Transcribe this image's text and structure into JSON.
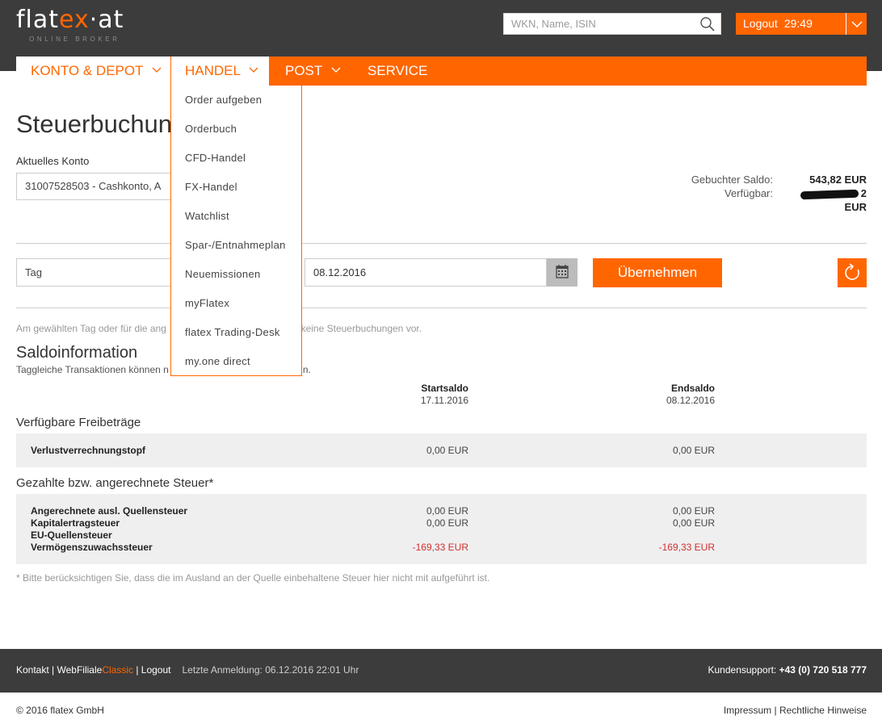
{
  "header": {
    "logo_main": "flat",
    "logo_accent": "ex",
    "logo_tail": "·at",
    "logo_sub": "ONLINE BROKER",
    "search_placeholder": "WKN, Name, ISIN",
    "logout_label": "Logout",
    "session_timer": "29:49"
  },
  "nav": {
    "items": [
      {
        "label": "KONTO & DEPOT"
      },
      {
        "label": "HANDEL"
      },
      {
        "label": "POST"
      },
      {
        "label": "SERVICE"
      }
    ]
  },
  "handel_menu": [
    "Order aufgeben",
    "Orderbuch",
    "CFD-Handel",
    "FX-Handel",
    "Watchlist",
    "Spar-/Entnahmeplan",
    "Neuemissionen",
    "myFlatex",
    "flatex Trading-Desk",
    "my.one direct"
  ],
  "page": {
    "title": "Steuerbuchungen",
    "account_label": "Aktuelles Konto",
    "account_value": "31007528503 - Cashkonto, A",
    "booked_balance_label": "Gebuchter Saldo:",
    "booked_balance_value": "543,82 EUR",
    "available_label": "Verfügbar:",
    "available_value_tail": "2 EUR"
  },
  "filter": {
    "period_value": "Tag",
    "date_value": "08.12.2016",
    "apply_label": "Übernehmen"
  },
  "info": {
    "text_start": "Am gewählten Tag oder für die ang",
    "text_end": "en keine Steuerbuchungen vor.",
    "section_title": "Saldoinformation",
    "sub_start": "Taggleiche Transaktionen können n",
    "sub_end": "n."
  },
  "columns": {
    "start_label": "Startsaldo",
    "start_date": "17.11.2016",
    "end_label": "Endsaldo",
    "end_date": "08.12.2016"
  },
  "freibetraege": {
    "title": "Verfügbare Freibeträge",
    "rows": [
      {
        "label": "Verlustverrechnungstopf",
        "start": "0,00 EUR",
        "end": "0,00 EUR"
      }
    ]
  },
  "steuer": {
    "title": "Gezahlte bzw. angerechnete Steuer*",
    "rows": [
      {
        "label": "Angerechnete ausl. Quellensteuer",
        "start": "0,00 EUR",
        "end": "0,00 EUR"
      },
      {
        "label": "Kapitalertragsteuer",
        "start": "0,00 EUR",
        "end": "0,00 EUR"
      },
      {
        "label": "EU-Quellensteuer",
        "start": "",
        "end": ""
      },
      {
        "label": "Vermögenszuwachssteuer",
        "start": "-169,33 EUR",
        "end": "-169,33 EUR"
      }
    ]
  },
  "footnote": "* Bitte berücksichtigen Sie, dass die im Ausland an der Quelle einbehaltene Steuer hier nicht mit aufgeführt ist.",
  "footer": {
    "kontakt": "Kontakt",
    "sep": " | ",
    "webfiliale": "WebFiliale",
    "classic": "Classic",
    "logout": "Logout",
    "last_login": "Letzte Anmeldung: 06.12.2016 22:01 Uhr",
    "support_label": "Kundensupport: ",
    "support_phone": "+43 (0) 720 518 777",
    "copyright": "© 2016 flatex GmbH",
    "impressum": "Impressum",
    "legal": "Rechtliche Hinweise"
  },
  "colors": {
    "brand": "#ff6600",
    "header_bg": "#3c3c3c",
    "negative": "#d03030"
  }
}
